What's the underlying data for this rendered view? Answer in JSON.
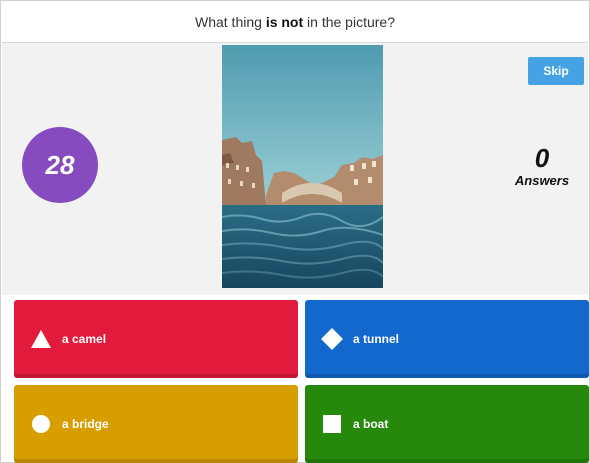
{
  "question": {
    "prefix": "What thing ",
    "emphasis": "is not",
    "suffix": " in the picture?"
  },
  "timer": {
    "value": "28",
    "color": "#864cbf"
  },
  "skip": {
    "label": "Skip",
    "color": "#45a3e5"
  },
  "answers_counter": {
    "count": "0",
    "label": "Answers"
  },
  "answers": [
    {
      "shape": "triangle-icon",
      "label": "a camel",
      "color": "#e21b3c"
    },
    {
      "shape": "diamond-icon",
      "label": "a tunnel",
      "color": "#1368ce"
    },
    {
      "shape": "circle-icon",
      "label": "a bridge",
      "color": "#d89e00"
    },
    {
      "shape": "square-icon",
      "label": "a boat",
      "color": "#26890c"
    }
  ]
}
